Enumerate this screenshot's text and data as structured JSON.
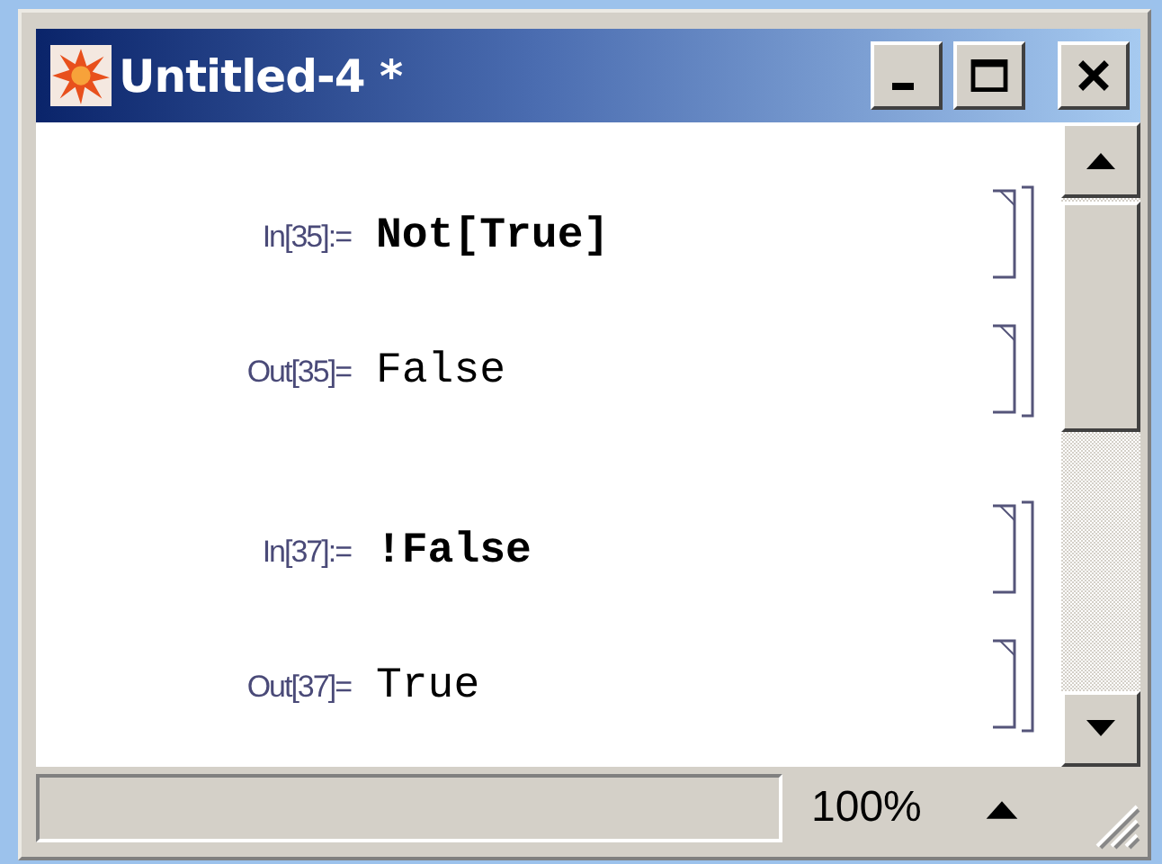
{
  "window": {
    "title": "Untitled-4 *"
  },
  "groups": [
    {
      "cells": [
        {
          "kind": "input",
          "label": "In[35]:=",
          "code": "Not[True]"
        },
        {
          "kind": "output",
          "label": "Out[35]=",
          "code": "False"
        }
      ]
    },
    {
      "cells": [
        {
          "kind": "input",
          "label": "In[37]:=",
          "code": "!False"
        },
        {
          "kind": "output",
          "label": "Out[37]=",
          "code": "True"
        }
      ]
    }
  ],
  "status_bar": {
    "zoom": "100%"
  }
}
